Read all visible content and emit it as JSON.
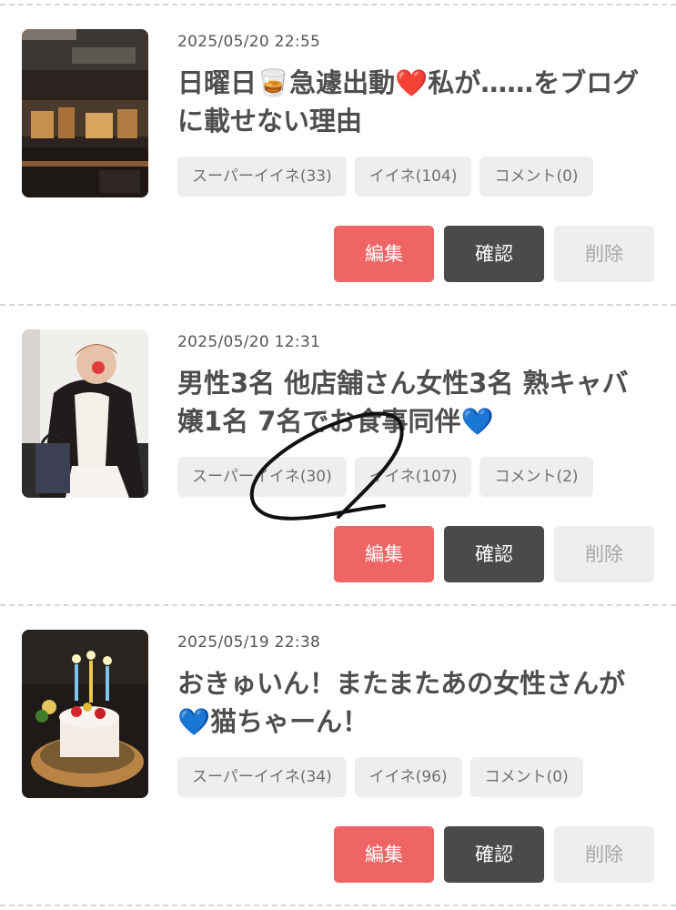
{
  "posts": [
    {
      "date": "2025/05/20 22:55",
      "title": "日曜日🥃急遽出動❤️私が……をブログに載せない理由",
      "thumbnail_icon": "bar-interior-photo",
      "tags": {
        "super_iine": "スーパーイイネ(33)",
        "iine": "イイネ(104)",
        "comment": "コメント(0)"
      },
      "buttons": {
        "edit": "編集",
        "confirm": "確認",
        "delete": "削除"
      }
    },
    {
      "date": "2025/05/20 12:31",
      "title": "男性3名 他店舗さん女性3名 熟キャバ嬢1名 7名でお食事同伴💙",
      "thumbnail_icon": "woman-selfie-photo",
      "tags": {
        "super_iine": "スーパーイイネ(30)",
        "iine": "イイネ(107)",
        "comment": "コメント(2)"
      },
      "buttons": {
        "edit": "編集",
        "confirm": "確認",
        "delete": "削除"
      }
    },
    {
      "date": "2025/05/19 22:38",
      "title": "おきゅいん！またまたあの女性さんが💙猫ちゃーん！",
      "thumbnail_icon": "birthday-cake-photo",
      "tags": {
        "super_iine": "スーパーイイネ(34)",
        "iine": "イイネ(96)",
        "comment": "コメント(0)"
      },
      "buttons": {
        "edit": "編集",
        "confirm": "確認",
        "delete": "削除"
      }
    }
  ],
  "colors": {
    "edit_button": "#ef6464",
    "confirm_button": "#4a4a4a",
    "delete_button": "#eeeeee",
    "tag_background": "#eeeeee",
    "title_text": "#4e4e4e"
  }
}
